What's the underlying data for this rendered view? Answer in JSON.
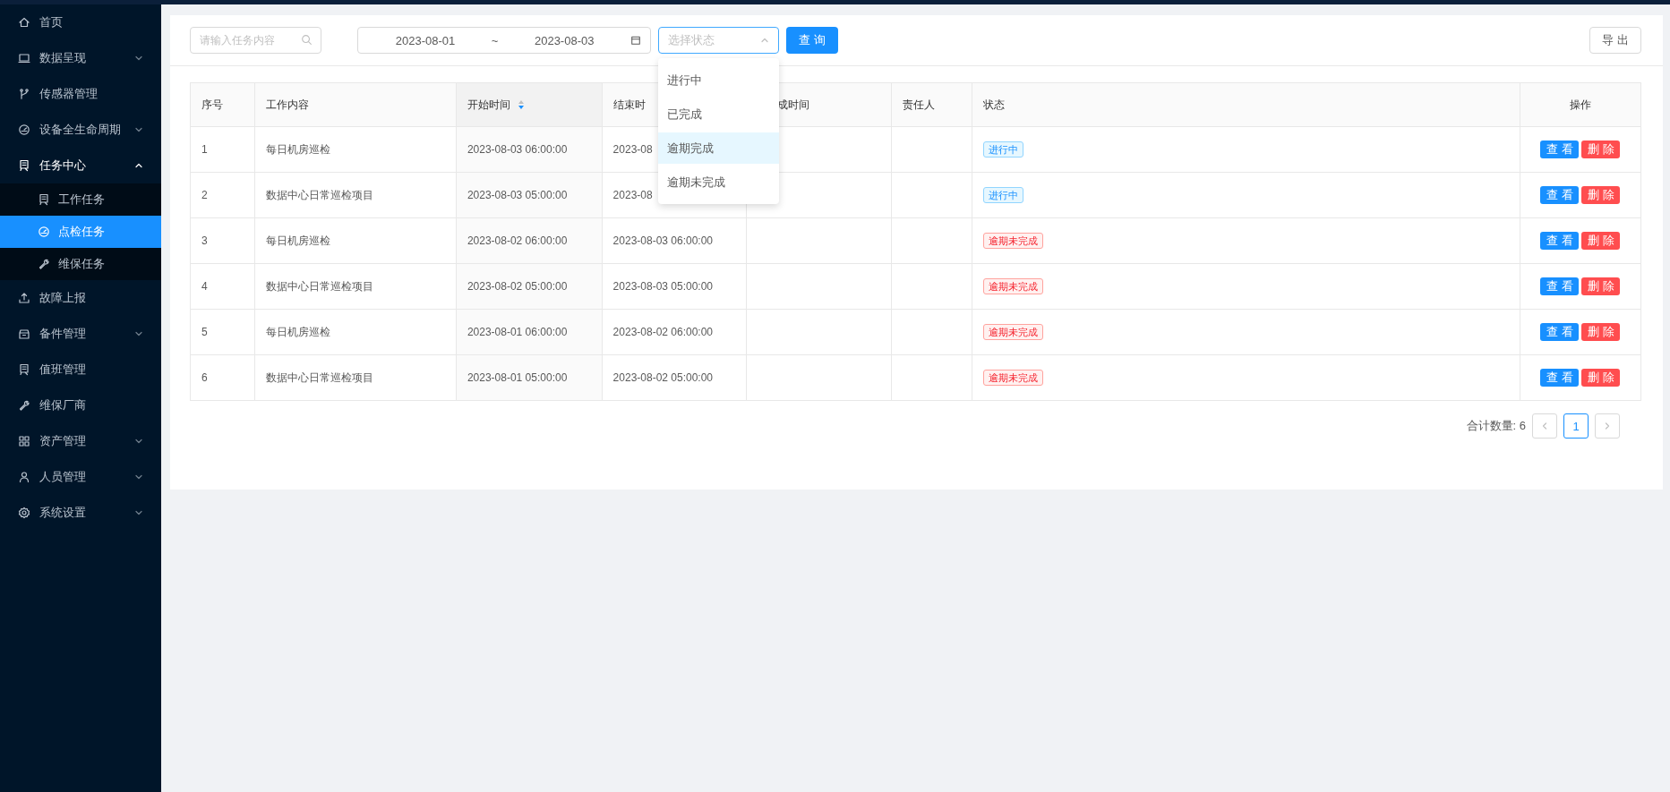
{
  "sidebar": {
    "items": [
      {
        "label": "首页",
        "kind": "link"
      },
      {
        "label": "数据呈现",
        "kind": "group",
        "expanded": false
      },
      {
        "label": "传感器管理",
        "kind": "link"
      },
      {
        "label": "设备全生命周期",
        "kind": "group",
        "expanded": false
      },
      {
        "label": "任务中心",
        "kind": "group",
        "expanded": true,
        "children": [
          {
            "label": "工作任务",
            "selected": false
          },
          {
            "label": "点检任务",
            "selected": true
          },
          {
            "label": "维保任务",
            "selected": false
          }
        ]
      },
      {
        "label": "故障上报",
        "kind": "link"
      },
      {
        "label": "备件管理",
        "kind": "group",
        "expanded": false
      },
      {
        "label": "值班管理",
        "kind": "link"
      },
      {
        "label": "维保厂商",
        "kind": "link"
      },
      {
        "label": "资产管理",
        "kind": "group",
        "expanded": false
      },
      {
        "label": "人员管理",
        "kind": "group",
        "expanded": false
      },
      {
        "label": "系统设置",
        "kind": "group",
        "expanded": false
      }
    ]
  },
  "toolbar": {
    "search": {
      "placeholder": "请输入任务内容"
    },
    "date_range": {
      "start": "2023-08-01",
      "separator": "~",
      "end": "2023-08-03"
    },
    "status_select": {
      "placeholder": "选择状态",
      "open": true,
      "options": [
        {
          "label": "进行中",
          "selected": false
        },
        {
          "label": "已完成",
          "selected": false
        },
        {
          "label": "逾期完成",
          "selected": true
        },
        {
          "label": "逾期未完成",
          "selected": false
        }
      ]
    },
    "query_button": "查 询",
    "export_button": "导 出"
  },
  "table": {
    "columns": [
      {
        "label": "序号"
      },
      {
        "label": "工作内容"
      },
      {
        "label": "开始时间",
        "sorted_descending": true
      },
      {
        "label": "结束时"
      },
      {
        "label": "成时间"
      },
      {
        "label": "责任人"
      },
      {
        "label": "状态"
      },
      {
        "label": "操作"
      }
    ],
    "rows": [
      {
        "no": "1",
        "content": "每日机房巡检",
        "start": "2023-08-03 06:00:00",
        "end": "2023-08",
        "status": {
          "label": "进行中",
          "kind": "in_progress"
        },
        "actions": [
          "查 看",
          "删 除"
        ]
      },
      {
        "no": "2",
        "content": "数据中心日常巡检项目",
        "start": "2023-08-03 05:00:00",
        "end": "2023-08",
        "status": {
          "label": "进行中",
          "kind": "in_progress"
        },
        "actions": [
          "查 看",
          "删 除"
        ]
      },
      {
        "no": "3",
        "content": "每日机房巡检",
        "start": "2023-08-02 06:00:00",
        "end": "2023-08-03 06:00:00",
        "status": {
          "label": "逾期未完成",
          "kind": "overdue"
        },
        "actions": [
          "查 看",
          "删 除"
        ]
      },
      {
        "no": "4",
        "content": "数据中心日常巡检项目",
        "start": "2023-08-02 05:00:00",
        "end": "2023-08-03 05:00:00",
        "status": {
          "label": "逾期未完成",
          "kind": "overdue"
        },
        "actions": [
          "查 看",
          "删 除"
        ]
      },
      {
        "no": "5",
        "content": "每日机房巡检",
        "start": "2023-08-01 06:00:00",
        "end": "2023-08-02 06:00:00",
        "status": {
          "label": "逾期未完成",
          "kind": "overdue"
        },
        "actions": [
          "查 看",
          "删 除"
        ]
      },
      {
        "no": "6",
        "content": "数据中心日常巡检项目",
        "start": "2023-08-01 05:00:00",
        "end": "2023-08-02 05:00:00",
        "status": {
          "label": "逾期未完成",
          "kind": "overdue"
        },
        "actions": [
          "查 看",
          "删 除"
        ]
      }
    ]
  },
  "pagination": {
    "total_label": "合计数量:",
    "total": "6",
    "pages": [
      {
        "label": "1",
        "selected": true
      }
    ]
  }
}
